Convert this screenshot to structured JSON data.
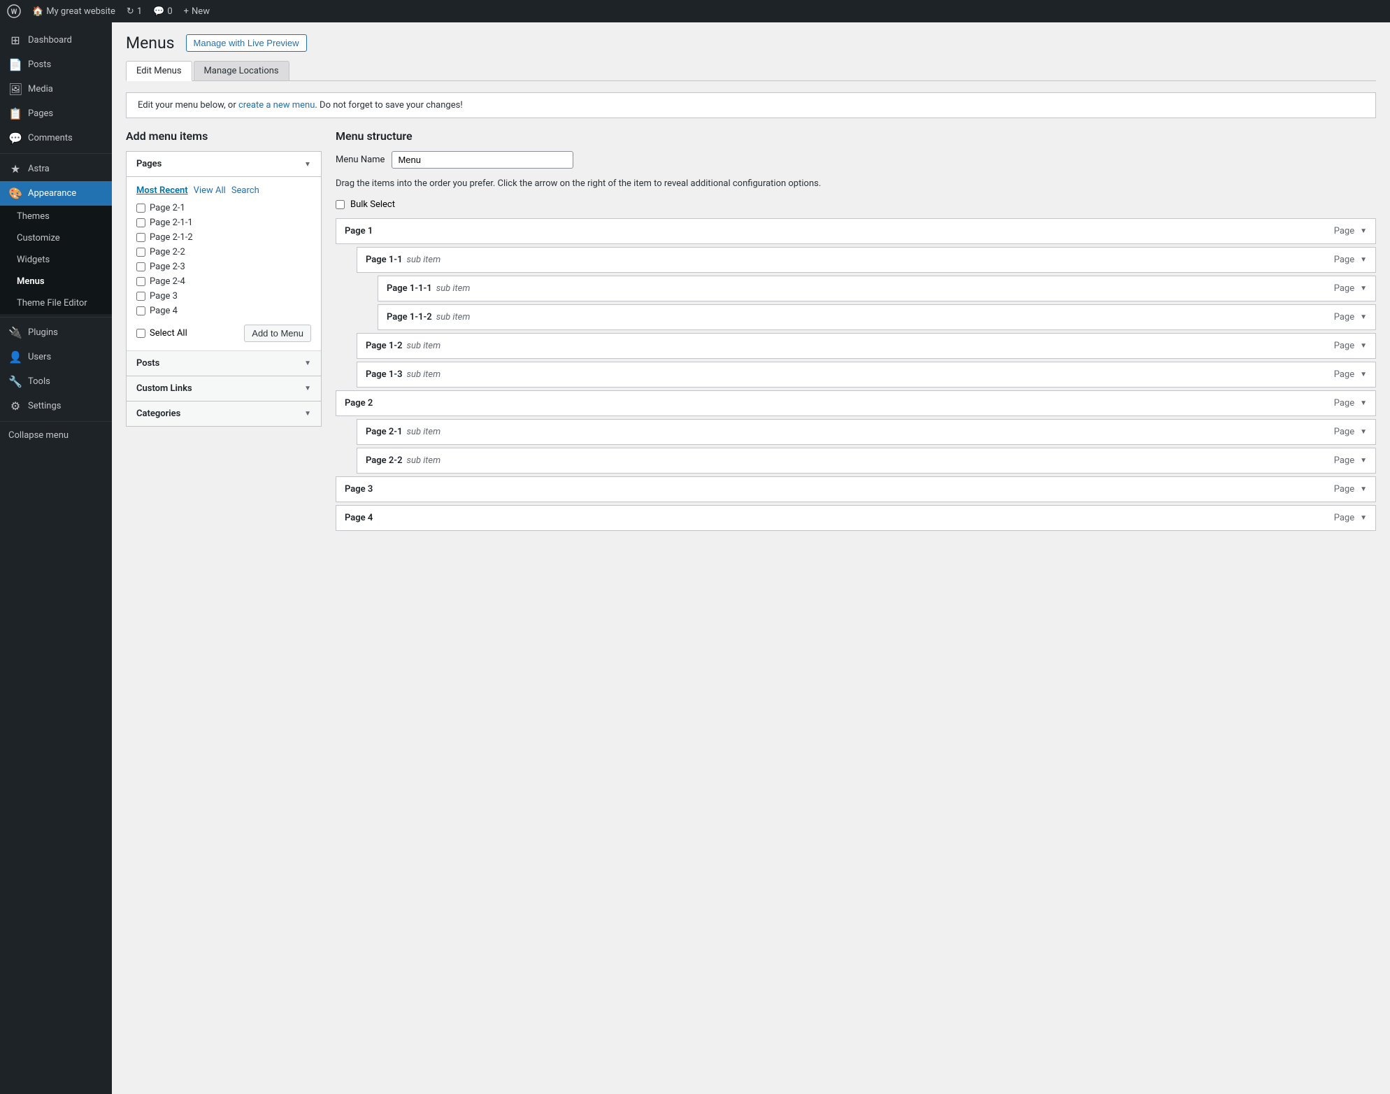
{
  "topbar": {
    "site_name": "My great website",
    "updates": "1",
    "comments": "0",
    "new_label": "New",
    "wp_icon": "⊞"
  },
  "sidebar": {
    "items": [
      {
        "id": "dashboard",
        "label": "Dashboard",
        "icon": "⊞"
      },
      {
        "id": "posts",
        "label": "Posts",
        "icon": "📄"
      },
      {
        "id": "media",
        "label": "Media",
        "icon": "🖼"
      },
      {
        "id": "pages",
        "label": "Pages",
        "icon": "📋"
      },
      {
        "id": "comments",
        "label": "Comments",
        "icon": "💬"
      },
      {
        "id": "astra",
        "label": "Astra",
        "icon": "★"
      },
      {
        "id": "appearance",
        "label": "Appearance",
        "icon": "🎨",
        "active": true
      },
      {
        "id": "plugins",
        "label": "Plugins",
        "icon": "🔌"
      },
      {
        "id": "users",
        "label": "Users",
        "icon": "👤"
      },
      {
        "id": "tools",
        "label": "Tools",
        "icon": "🔧"
      },
      {
        "id": "settings",
        "label": "Settings",
        "icon": "⚙"
      }
    ],
    "appearance_sub": [
      {
        "id": "themes",
        "label": "Themes"
      },
      {
        "id": "customize",
        "label": "Customize"
      },
      {
        "id": "widgets",
        "label": "Widgets"
      },
      {
        "id": "menus",
        "label": "Menus",
        "bold": true
      },
      {
        "id": "theme-file-editor",
        "label": "Theme File Editor"
      }
    ],
    "collapse_label": "Collapse menu"
  },
  "header": {
    "title": "Menus",
    "live_preview_btn": "Manage with Live Preview"
  },
  "tabs": [
    {
      "id": "edit-menus",
      "label": "Edit Menus",
      "active": true
    },
    {
      "id": "manage-locations",
      "label": "Manage Locations"
    }
  ],
  "notice": {
    "text": "Edit your menu below, or ",
    "link_text": "create a new menu",
    "text2": ". Do not forget to save your changes!"
  },
  "add_items": {
    "title": "Add menu items",
    "pages_section": {
      "label": "Pages",
      "open": true,
      "sub_tabs": [
        {
          "id": "most-recent",
          "label": "Most Recent",
          "active": true
        },
        {
          "id": "view-all",
          "label": "View All"
        },
        {
          "id": "search",
          "label": "Search"
        }
      ],
      "items": [
        {
          "id": "p1",
          "label": "Page 2-1"
        },
        {
          "id": "p2",
          "label": "Page 2-1-1"
        },
        {
          "id": "p3",
          "label": "Page 2-1-2"
        },
        {
          "id": "p4",
          "label": "Page 2-2"
        },
        {
          "id": "p5",
          "label": "Page 2-3"
        },
        {
          "id": "p6",
          "label": "Page 2-4"
        },
        {
          "id": "p7",
          "label": "Page 3"
        },
        {
          "id": "p8",
          "label": "Page 4"
        }
      ],
      "select_all_label": "Select All",
      "add_btn": "Add to Menu"
    },
    "posts_section": {
      "label": "Posts"
    },
    "custom_links_section": {
      "label": "Custom Links"
    },
    "categories_section": {
      "label": "Categories"
    }
  },
  "menu_structure": {
    "title": "Menu structure",
    "menu_name_label": "Menu Name",
    "menu_name_value": "Menu",
    "drag_hint": "Drag the items into the order you prefer. Click the arrow on the right of the item to reveal additional configuration options.",
    "bulk_select_label": "Bulk Select",
    "items": [
      {
        "id": "page1",
        "label": "Page 1",
        "sub_label": "",
        "type": "Page",
        "level": 1
      },
      {
        "id": "page1-1",
        "label": "Page 1-1",
        "sub_label": "sub item",
        "type": "Page",
        "level": 2
      },
      {
        "id": "page1-1-1",
        "label": "Page 1-1-1",
        "sub_label": "sub item",
        "type": "Page",
        "level": 3
      },
      {
        "id": "page1-1-2",
        "label": "Page 1-1-2",
        "sub_label": "sub item",
        "type": "Page",
        "level": 3
      },
      {
        "id": "page1-2",
        "label": "Page 1-2",
        "sub_label": "sub item",
        "type": "Page",
        "level": 2
      },
      {
        "id": "page1-3",
        "label": "Page 1-3",
        "sub_label": "sub item",
        "type": "Page",
        "level": 2
      },
      {
        "id": "page2",
        "label": "Page 2",
        "sub_label": "",
        "type": "Page",
        "level": 1
      },
      {
        "id": "page2-1",
        "label": "Page 2-1",
        "sub_label": "sub item",
        "type": "Page",
        "level": 2
      },
      {
        "id": "page2-2",
        "label": "Page 2-2",
        "sub_label": "sub item",
        "type": "Page",
        "level": 2
      },
      {
        "id": "page3",
        "label": "Page 3",
        "sub_label": "",
        "type": "Page",
        "level": 1
      },
      {
        "id": "page4",
        "label": "Page 4",
        "sub_label": "",
        "type": "Page",
        "level": 1
      }
    ]
  }
}
